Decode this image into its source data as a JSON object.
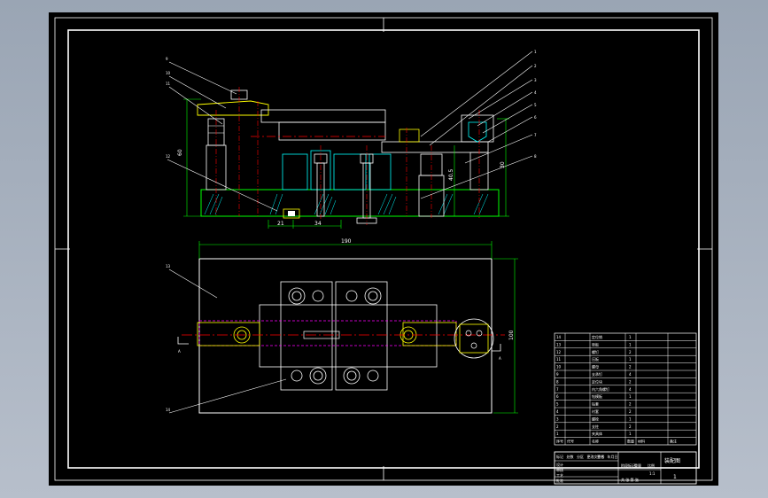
{
  "drawing": {
    "dimensions": {
      "plan_width": "190",
      "plan_height": "100",
      "front_height": "60",
      "right_height": "30",
      "mid_height": "40.5",
      "bottom_left": "21",
      "bottom_mid": "34"
    },
    "section_marks": {
      "left": "A",
      "right": "A"
    },
    "leader_numbers": [
      "1",
      "2",
      "3",
      "4",
      "5",
      "6",
      "7",
      "8",
      "9",
      "10",
      "11",
      "12",
      "13",
      "14"
    ],
    "title_block": {
      "drawing_name": "装配图",
      "sheet": "1",
      "scale": "1:1",
      "headers": [
        "序号",
        "代号",
        "名称",
        "数量",
        "材料",
        "备注"
      ],
      "parts": [
        {
          "no": "14",
          "name": "定位销",
          "qty": "1"
        },
        {
          "no": "13",
          "name": "垫板",
          "qty": "1"
        },
        {
          "no": "12",
          "name": "螺钉",
          "qty": "2"
        },
        {
          "no": "11",
          "name": "压板",
          "qty": "1"
        },
        {
          "no": "10",
          "name": "螺母",
          "qty": "2"
        },
        {
          "no": "9",
          "name": "支承钉",
          "qty": "4"
        },
        {
          "no": "8",
          "name": "定位块",
          "qty": "2"
        },
        {
          "no": "7",
          "name": "内六角螺钉",
          "qty": "4"
        },
        {
          "no": "6",
          "name": "钻模板",
          "qty": "1"
        },
        {
          "no": "5",
          "name": "钻套",
          "qty": "2"
        },
        {
          "no": "4",
          "name": "衬套",
          "qty": "2"
        },
        {
          "no": "3",
          "name": "螺栓",
          "qty": "1"
        },
        {
          "no": "2",
          "name": "支柱",
          "qty": "2"
        },
        {
          "no": "1",
          "name": "夹具体",
          "qty": "1"
        }
      ],
      "bottom_labels": [
        "标记",
        "处数",
        "分区",
        "更改文件号",
        "签名",
        "年月日"
      ],
      "roles": [
        "设计",
        "审核",
        "工艺",
        "批准"
      ],
      "stage_labels": [
        "阶段标记",
        "重量",
        "比例"
      ],
      "share_label": "共 张 第 张"
    }
  }
}
